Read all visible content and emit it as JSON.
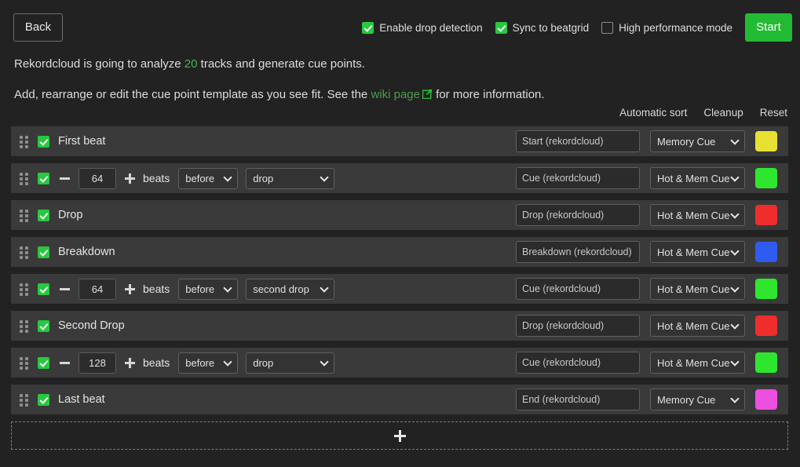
{
  "header": {
    "back_label": "Back",
    "start_label": "Start",
    "options": [
      {
        "label": "Enable drop detection",
        "checked": true
      },
      {
        "label": "Sync to beatgrid",
        "checked": true
      },
      {
        "label": "High performance mode",
        "checked": false
      }
    ]
  },
  "description": {
    "line1_pre": "Rekordcloud is going to analyze ",
    "track_count": "20",
    "line1_post": " tracks and generate cue points.",
    "line2_pre": "Add, rearrange or edit the cue point template as you see fit. See the ",
    "wiki_link": "wiki page",
    "line2_post": " for more information."
  },
  "actions": {
    "automatic_sort": "Automatic sort",
    "cleanup": "Cleanup",
    "reset": "Reset"
  },
  "labels": {
    "beats": "beats"
  },
  "rows": [
    {
      "type": "simple",
      "enabled": true,
      "title": "First beat",
      "name_value": "Start (rekordcloud)",
      "cue_type": "Memory Cue",
      "color": "#e8e032"
    },
    {
      "type": "offset",
      "enabled": true,
      "beats": "64",
      "direction": "before",
      "target": "drop",
      "name_value": "Cue (rekordcloud)",
      "cue_type": "Hot & Mem Cue",
      "color": "#2ee62e"
    },
    {
      "type": "simple",
      "enabled": true,
      "title": "Drop",
      "name_value": "Drop (rekordcloud)",
      "cue_type": "Hot & Mem Cue",
      "color": "#ef2d2d"
    },
    {
      "type": "simple",
      "enabled": true,
      "title": "Breakdown",
      "name_value": "Breakdown (rekordcloud)",
      "cue_type": "Hot & Mem Cue",
      "color": "#2f5bf0"
    },
    {
      "type": "offset",
      "enabled": true,
      "beats": "64",
      "direction": "before",
      "target": "second drop",
      "name_value": "Cue (rekordcloud)",
      "cue_type": "Hot & Mem Cue",
      "color": "#2ee62e"
    },
    {
      "type": "simple",
      "enabled": true,
      "title": "Second Drop",
      "name_value": "Drop (rekordcloud)",
      "cue_type": "Hot & Mem Cue",
      "color": "#ef2d2d"
    },
    {
      "type": "offset",
      "enabled": true,
      "beats": "128",
      "direction": "before",
      "target": "drop",
      "name_value": "Cue (rekordcloud)",
      "cue_type": "Hot & Mem Cue",
      "color": "#2ee62e"
    },
    {
      "type": "simple",
      "enabled": true,
      "title": "Last beat",
      "name_value": "End (rekordcloud)",
      "cue_type": "Memory Cue",
      "color": "#ee4fe0"
    }
  ],
  "add_row": {
    "icon": "plus-icon"
  }
}
